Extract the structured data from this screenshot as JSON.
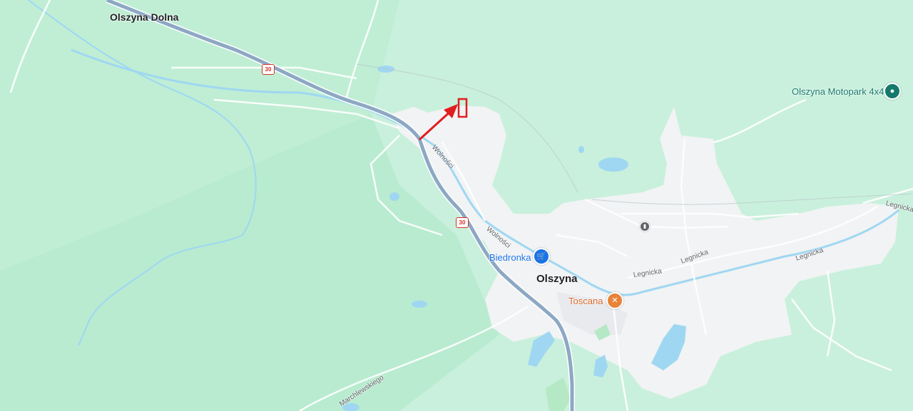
{
  "map": {
    "places": {
      "olszyna_dolna": "Olszyna Dolna",
      "olszyna": "Olszyna"
    },
    "pois": {
      "motopark": "Olszyna Motopark 4x4",
      "biedronka": "Biedronka",
      "toscana": "Toscana"
    },
    "streets": {
      "wolnosci_1": "Wolności",
      "wolnosci_2": "Wolności",
      "legnicka_1": "Legnicka",
      "legnicka_2": "Legnicka",
      "legnicka_3": "Legnicka",
      "legnicka_4": "Legnicka",
      "marchlewskiego": "Marchlewskiego"
    },
    "road_shields": {
      "shield_1": "30",
      "shield_2": "30"
    },
    "icons": {
      "biedronka": "shopping-cart-icon",
      "toscana": "restaurant-icon",
      "motopark": "place-pin-icon",
      "station": "train-station-icon"
    },
    "colors": {
      "background": "#c9f0dc",
      "urban": "#f1f3f4",
      "water": "#9fd7f2",
      "road_main": "#8da8c4",
      "annotation": "#e01e1e"
    }
  }
}
